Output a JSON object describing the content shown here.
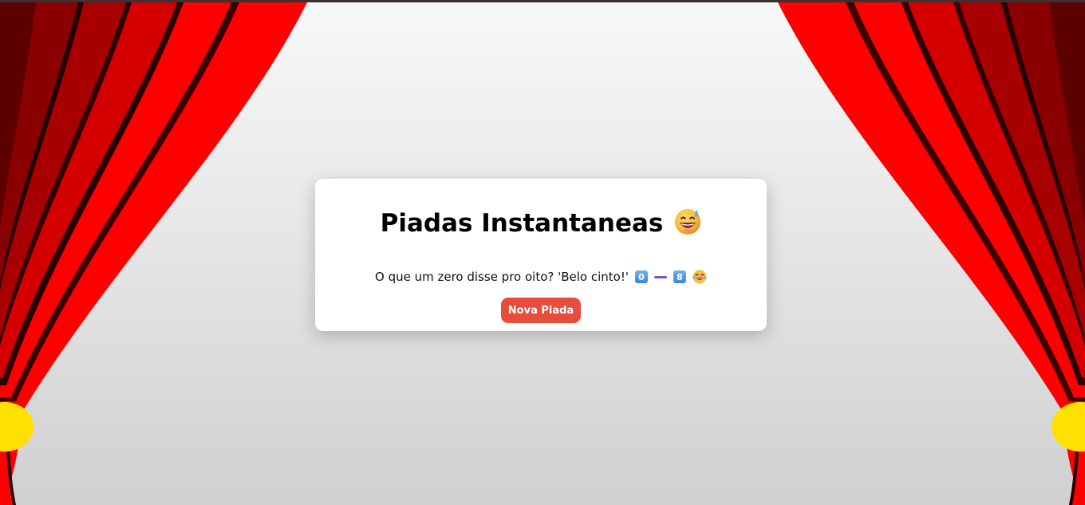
{
  "header": {
    "title": "Piadas Instantaneas",
    "title_emoji": "sweat-smile-emoji"
  },
  "joke": {
    "text": "O que um zero disse pro oito? 'Belo cinto!'",
    "keycap_zero": "0",
    "keycap_eight": "8",
    "trailing_emoji": "tears-of-joy-emoji"
  },
  "actions": {
    "new_joke_label": "Nova Piada"
  },
  "colors": {
    "button": "#e74c3c",
    "curtain_red": "#ff0000",
    "curtain_dark": "#5c0000",
    "tieback": "#ffe000"
  }
}
